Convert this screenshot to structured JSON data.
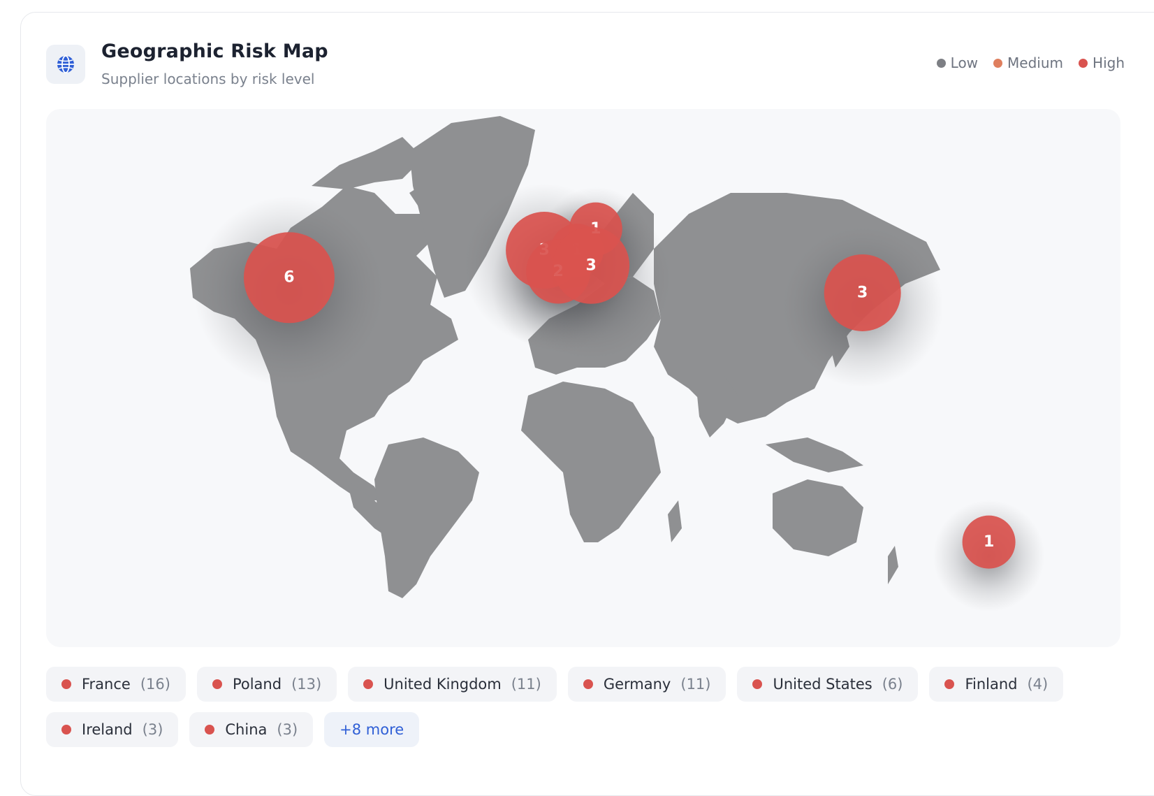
{
  "header": {
    "title": "Geographic Risk Map",
    "subtitle": "Supplier locations by risk level",
    "icon": "globe-icon"
  },
  "legend": [
    {
      "label": "Low",
      "color": "#7d7f84"
    },
    {
      "label": "Medium",
      "color": "#df7f5e"
    },
    {
      "label": "High",
      "color": "#d9534f"
    }
  ],
  "map": {
    "land_color": "#8f9092",
    "background": "#f7f8fa",
    "clusters": [
      {
        "count": 6,
        "lat": 48,
        "lon": -123,
        "risk": "High"
      },
      {
        "count": 3,
        "lat": 57,
        "lon": -14,
        "risk": "High"
      },
      {
        "count": 1,
        "lat": 57,
        "lon": 0,
        "risk": "High"
      },
      {
        "count": 1,
        "lat": 64,
        "lon": 8,
        "risk": "High"
      },
      {
        "count": 2,
        "lat": 50,
        "lon": -8,
        "risk": "High"
      },
      {
        "count": 3,
        "lat": 52,
        "lon": 6,
        "risk": "High"
      },
      {
        "count": 3,
        "lat": 43,
        "lon": 122,
        "risk": "High"
      },
      {
        "count": 1,
        "lat": -39,
        "lon": 176,
        "risk": "High"
      }
    ]
  },
  "countries": [
    {
      "name": "France",
      "count": "(16)"
    },
    {
      "name": "Poland",
      "count": "(13)"
    },
    {
      "name": "United Kingdom",
      "count": "(11)"
    },
    {
      "name": "Germany",
      "count": "(11)"
    },
    {
      "name": "United States",
      "count": "(6)"
    },
    {
      "name": "Finland",
      "count": "(4)"
    },
    {
      "name": "Ireland",
      "count": "(3)"
    },
    {
      "name": "China",
      "count": "(3)"
    }
  ],
  "more_label": "+8 more"
}
